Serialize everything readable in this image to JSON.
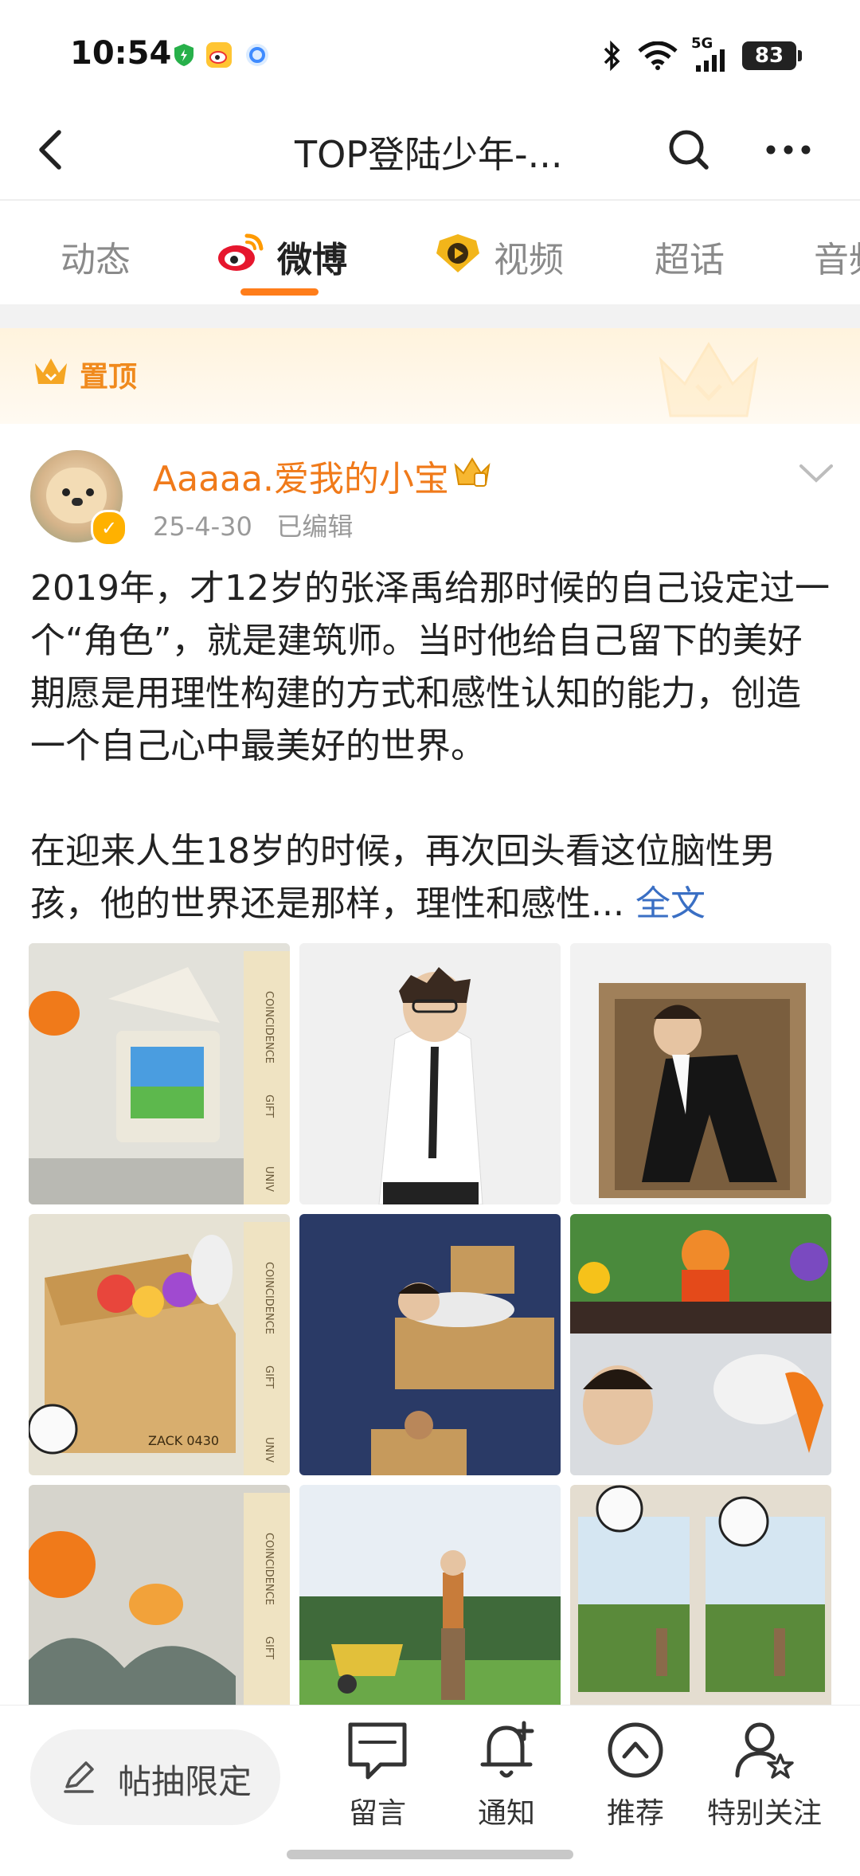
{
  "status_bar": {
    "time": "10:54",
    "network": "5G",
    "battery": "83"
  },
  "nav": {
    "title": "TOP登陆少年-..."
  },
  "tabs": [
    {
      "label": "动态"
    },
    {
      "label": "微博"
    },
    {
      "label": "视频"
    },
    {
      "label": "超话"
    },
    {
      "label": "音频"
    }
  ],
  "pinned": {
    "label": "置顶"
  },
  "post": {
    "username": "Aaaaa.爱我的小宝",
    "date": "25-4-30",
    "edited": "已编辑",
    "paragraph1": "2019年，才12岁的张泽禹给那时候的自己设定过一个“角色”，就是建筑师。当时他给自己留下的美好期愿是用理性构建的方式和感性认知的能力，创造一个自己心中最美好的世界。",
    "paragraph2": "在迎来人生18岁的时候，再次回头看这位脑性男孩，他的世界还是那样，理性和感性...",
    "full_text_link": "全文",
    "grid_text": {
      "coincidence": "COINCIDENCE",
      "gift": "GIFT",
      "univ": "UNIV",
      "zack": "ZACK 0430"
    }
  },
  "bottom_bar": {
    "comment_placeholder": "帖抽限定",
    "items": [
      {
        "label": "留言",
        "icon": "comment-icon"
      },
      {
        "label": "通知",
        "icon": "bell-plus-icon"
      },
      {
        "label": "推荐",
        "icon": "recommend-icon"
      },
      {
        "label": "特别关注",
        "icon": "special-follow-icon"
      }
    ]
  },
  "colors": {
    "accent": "#ff7d1a",
    "username": "#f07a1a",
    "link": "#3a6fc4",
    "pinned_bg": "#fff3dd"
  }
}
